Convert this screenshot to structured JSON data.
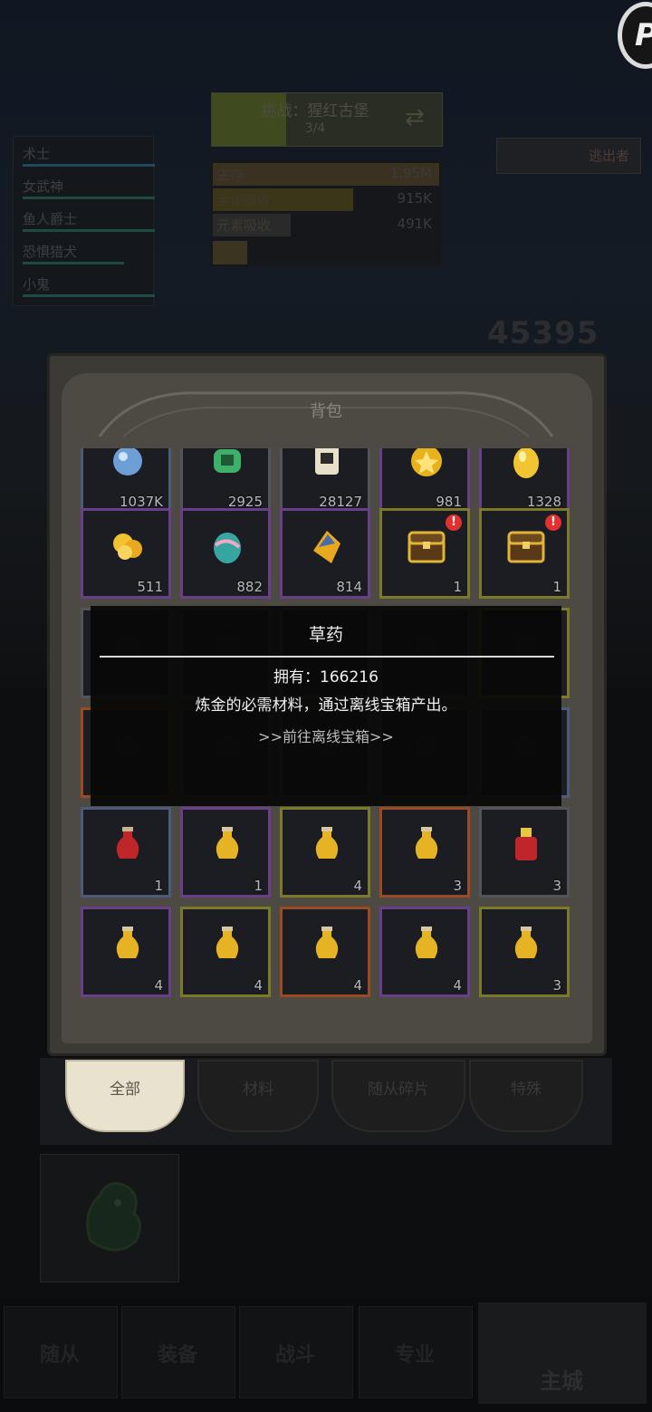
{
  "background": {
    "stage": {
      "name": "挑战：猩红古堡",
      "progress": "3/4"
    },
    "heroes": [
      "术士",
      "女武神",
      "鱼人爵士",
      "恐惧猎犬",
      "小鬼"
    ],
    "stats": [
      {
        "label": "生存",
        "value": "1.95M"
      },
      {
        "label": "全伤吸收",
        "value": "915K"
      },
      {
        "label": "元素吸收",
        "value": "491K"
      }
    ],
    "escape_label": "逃出者",
    "power": "45395",
    "tabs": [
      {
        "label": "全部",
        "active": true
      },
      {
        "label": "材料",
        "active": false
      },
      {
        "label": "随从碎片",
        "active": false
      },
      {
        "label": "特殊",
        "active": false
      }
    ],
    "nav": [
      "随从",
      "装备",
      "战斗",
      "专业"
    ],
    "city_label": "主城",
    "corner_logo": "P"
  },
  "panel": {
    "title": "背包",
    "rows": [
      [
        {
          "icon": "blue-gem-icon",
          "count": "1037K",
          "quality": "blue"
        },
        {
          "icon": "green-herb-icon",
          "count": "2925",
          "quality": "grey"
        },
        {
          "icon": "scroll-icon",
          "count": "28127",
          "quality": "grey"
        },
        {
          "icon": "gold-coin-icon",
          "count": "981",
          "quality": "purple"
        },
        {
          "icon": "gold-egg-icon",
          "count": "1328",
          "quality": "purple"
        }
      ],
      [
        {
          "icon": "gold-ore-icon",
          "count": "511",
          "quality": "purple"
        },
        {
          "icon": "teal-egg-icon",
          "count": "882",
          "quality": "purple"
        },
        {
          "icon": "crystal-icon",
          "count": "814",
          "quality": "purple"
        },
        {
          "icon": "treasure-chest-icon",
          "count": "1",
          "quality": "gold",
          "alert": true
        },
        {
          "icon": "treasure-chest-icon",
          "count": "1",
          "quality": "gold",
          "alert": true
        }
      ],
      [
        {
          "icon": "item-icon",
          "count": "",
          "quality": "grey"
        },
        {
          "icon": "item-icon",
          "count": "",
          "quality": "grey"
        },
        {
          "icon": "item-icon",
          "count": "",
          "quality": "grey"
        },
        {
          "icon": "item-icon",
          "count": "",
          "quality": "grey"
        },
        {
          "icon": "item-icon",
          "count": "",
          "quality": "gold"
        }
      ],
      [
        {
          "icon": "item-icon",
          "count": "",
          "quality": "orange"
        },
        {
          "icon": "item-icon",
          "count": "",
          "quality": "grey"
        },
        {
          "icon": "item-icon",
          "count": "",
          "quality": "grey"
        },
        {
          "icon": "item-icon",
          "count": "",
          "quality": "grey"
        },
        {
          "icon": "item-icon",
          "count": "",
          "quality": "blue"
        }
      ],
      [
        {
          "icon": "red-potion-icon",
          "count": "1",
          "quality": "blue"
        },
        {
          "icon": "gold-potion-icon",
          "count": "1",
          "quality": "purple"
        },
        {
          "icon": "gold-potion-icon",
          "count": "4",
          "quality": "gold"
        },
        {
          "icon": "gold-potion-icon",
          "count": "3",
          "quality": "orange"
        },
        {
          "icon": "red-flask-icon",
          "count": "3",
          "quality": "grey"
        }
      ],
      [
        {
          "icon": "gold-potion-icon",
          "count": "4",
          "quality": "purple"
        },
        {
          "icon": "gold-potion-icon",
          "count": "4",
          "quality": "gold"
        },
        {
          "icon": "gold-potion-icon",
          "count": "4",
          "quality": "orange"
        },
        {
          "icon": "gold-potion-icon",
          "count": "4",
          "quality": "purple"
        },
        {
          "icon": "gold-potion-icon",
          "count": "3",
          "quality": "gold"
        }
      ]
    ]
  },
  "tooltip": {
    "title": "草药",
    "owned": "拥有：166216",
    "description": "炼金的必需材料，通过离线宝箱产出。",
    "link": ">>前往离线宝箱>>"
  },
  "colors": {
    "quality_blue": "#4c5a7c",
    "quality_purple": "#6a3f8a",
    "quality_gold": "#7c7a28",
    "quality_orange": "#9b4a22",
    "quality_grey": "#51545a",
    "alert_red": "#e03030"
  }
}
